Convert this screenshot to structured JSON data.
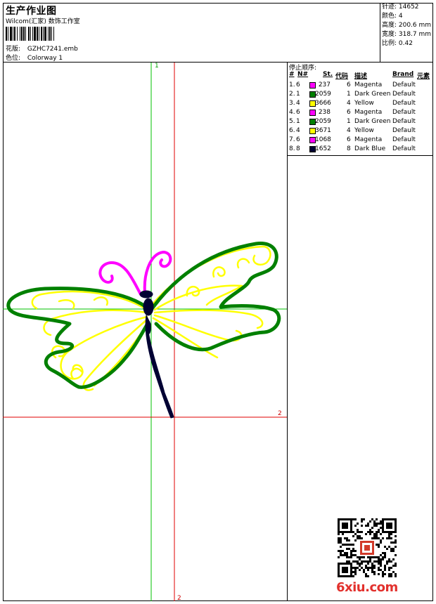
{
  "header": {
    "title": "生产作业图",
    "subtitle": "Wilcom(汇家) 数饰工作室",
    "design_label": "花版:",
    "design_value": "GZHC7241.emb",
    "colorway_label": "色位:",
    "colorway_value": "Colorway 1"
  },
  "stats": {
    "stitches": "针迹: 14652",
    "colors": "颜色: 4",
    "height": "高度: 200.6 mm",
    "width": "宽度: 318.7 mm",
    "scale": "比例: 0.42"
  },
  "stop_panel": {
    "title": "停止顺序:",
    "headers": [
      "#",
      "N#",
      "St.",
      "代码",
      "描述",
      "Brand",
      "元素"
    ],
    "rows": [
      {
        "idx": "1.",
        "n": "6",
        "color": "#ff00ff",
        "st": "237",
        "code": "6",
        "desc": "Magenta",
        "brand": "Default"
      },
      {
        "idx": "2.",
        "n": "1",
        "color": "#008000",
        "st": "2059",
        "code": "1",
        "desc": "Dark Green",
        "brand": "Default"
      },
      {
        "idx": "3.",
        "n": "4",
        "color": "#ffff00",
        "st": "3666",
        "code": "4",
        "desc": "Yellow",
        "brand": "Default"
      },
      {
        "idx": "4.",
        "n": "6",
        "color": "#ff00ff",
        "st": "238",
        "code": "6",
        "desc": "Magenta",
        "brand": "Default"
      },
      {
        "idx": "5.",
        "n": "1",
        "color": "#008000",
        "st": "2059",
        "code": "1",
        "desc": "Dark Green",
        "brand": "Default"
      },
      {
        "idx": "6.",
        "n": "4",
        "color": "#ffff00",
        "st": "3671",
        "code": "4",
        "desc": "Yellow",
        "brand": "Default"
      },
      {
        "idx": "7.",
        "n": "6",
        "color": "#ff00ff",
        "st": "1068",
        "code": "6",
        "desc": "Magenta",
        "brand": "Default"
      },
      {
        "idx": "8.",
        "n": "8",
        "color": "#000033",
        "st": "1652",
        "code": "8",
        "desc": "Dark Blue",
        "brand": "Default"
      }
    ]
  },
  "markers": {
    "top": "1",
    "right": "2",
    "bottom": "2"
  },
  "watermark": {
    "logo_text": "6xiu.com"
  },
  "colors": {
    "magenta": "#ff00ff",
    "dark_green": "#008000",
    "yellow": "#ffff00",
    "dark_blue": "#000033",
    "guide_red": "#e00000",
    "guide_green": "#00c000"
  }
}
